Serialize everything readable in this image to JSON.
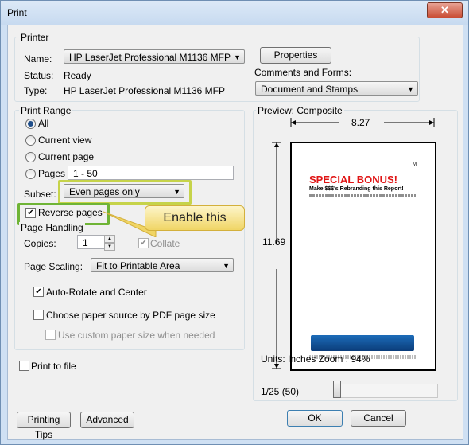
{
  "window": {
    "title": "Print",
    "close_glyph": "✕"
  },
  "printer": {
    "group_label": "Printer",
    "name_label": "Name:",
    "name_value": "HP LaserJet Professional M1136 MFP",
    "properties_button": "Properties",
    "status_label": "Status:",
    "status_value": "Ready",
    "type_label": "Type:",
    "type_value": "HP LaserJet Professional M1136 MFP",
    "comments_label": "Comments and Forms:",
    "comments_value": "Document and Stamps"
  },
  "print_range": {
    "group_label": "Print Range",
    "all_label": "All",
    "current_view_label": "Current view",
    "current_page_label": "Current page",
    "pages_label": "Pages",
    "pages_value": "1 - 50",
    "selected": "All",
    "subset_label": "Subset:",
    "subset_value": "Even pages only",
    "reverse_pages_label": "Reverse pages",
    "reverse_pages_checked": true
  },
  "callout": {
    "text": "Enable this"
  },
  "page_handling": {
    "group_label": "Page Handling",
    "copies_label": "Copies:",
    "copies_value": "1",
    "collate_label": "Collate",
    "collate_checked": true,
    "scaling_label": "Page Scaling:",
    "scaling_value": "Fit to Printable Area",
    "auto_rotate_label": "Auto-Rotate and Center",
    "auto_rotate_checked": true,
    "paper_source_label": "Choose paper source by PDF page size",
    "paper_source_checked": false,
    "custom_size_label": "Use custom paper size when needed",
    "custom_size_checked": false
  },
  "print_to_file_label": "Print to file",
  "preview": {
    "label": "Preview: Composite",
    "width_value": "8.27",
    "height_value": "11.69",
    "page_heading": "SPECIAL BONUS!",
    "page_subheading": "Make $$$'s Rebranding this Report!",
    "page_marker": "M",
    "units_text": "Units: Inches Zoom :  94%",
    "page_counter": "1/25 (50)",
    "slider_position": 0.0
  },
  "buttons": {
    "printing_tips": "Printing Tips",
    "advanced": "Advanced",
    "ok": "OK",
    "cancel": "Cancel"
  },
  "colors": {
    "callout_fill": "#f0d565",
    "highlight_yellow": "#c6d34a",
    "highlight_green": "#6fb436",
    "bonus_red": "#e01515"
  }
}
